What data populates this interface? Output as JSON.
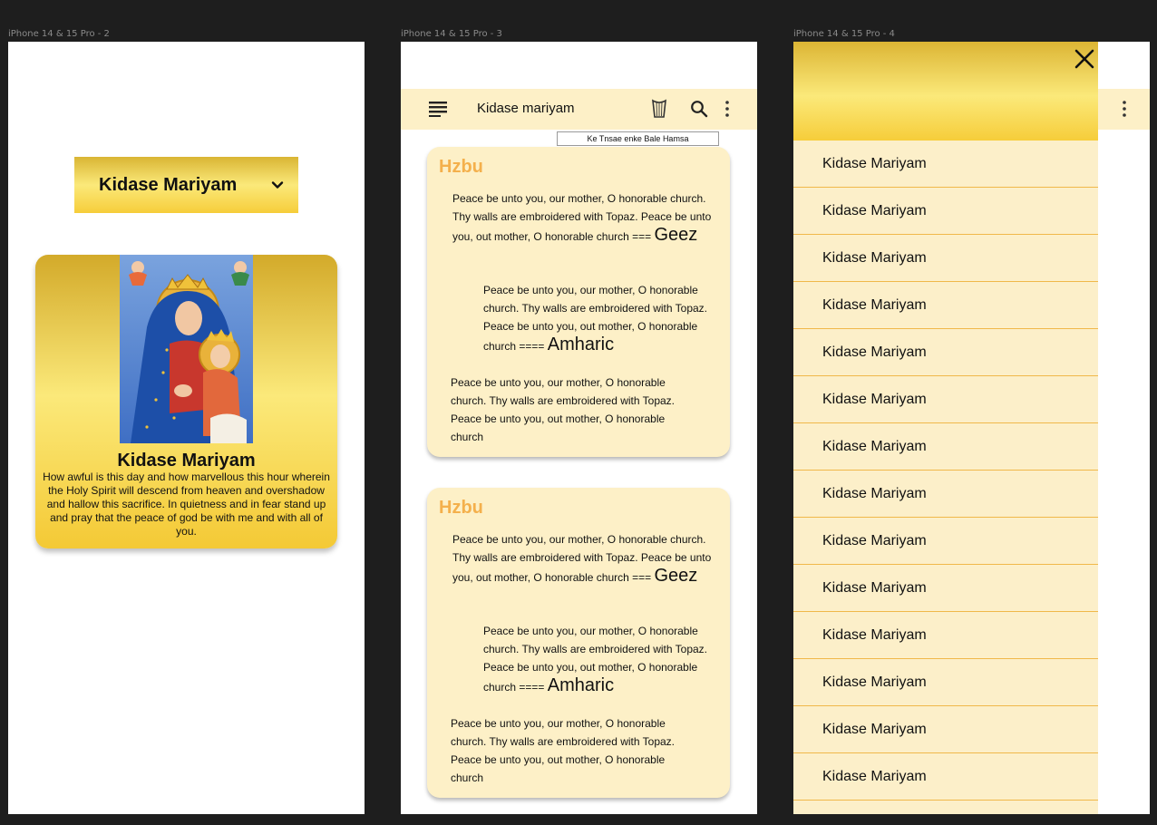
{
  "frames": [
    {
      "label": "iPhone 14 & 15 Pro - 2"
    },
    {
      "label": "iPhone 14 & 15 Pro - 3"
    },
    {
      "label": "iPhone 14 & 15 Pro - 4"
    }
  ],
  "home": {
    "select_label": "Kidase Mariyam",
    "card_title": "Kidase Mariyam",
    "card_desc": "How awful is this day and how marvellous this hour wherein the Holy Spirit will descend from heaven and overshadow and hallow this sacrifice. In quietness and in fear stand up and pray that the peace of god be with me and with all of you."
  },
  "reader": {
    "appbar_title": "Kidase mariyam",
    "tooltip": "Ke Tnsae enke Bale Hamsa",
    "cards": [
      {
        "heading": "Hzbu",
        "geez_text": "Peace be unto you, our mother, O honorable church. Thy walls are embroidered with Topaz. Peace be unto you, out mother, O honorable church ===",
        "geez_label": "Geez",
        "amharic_text": "Peace be unto you, our mother, O honorable church. Thy walls are embroidered with Topaz. Peace be unto you, out mother, O honorable church ====",
        "amharic_label": "Amharic",
        "english_text": "Peace be unto you, our mother, O honorable church. Thy walls are embroidered with Topaz. Peace be unto you, out mother, O honorable church"
      },
      {
        "heading": "Hzbu",
        "geez_text": "Peace be unto you, our mother, O honorable church. Thy walls are embroidered with Topaz. Peace be unto you, out mother, O honorable church ===",
        "geez_label": "Geez",
        "amharic_text": "Peace be unto you, our mother, O honorable church. Thy walls are embroidered with Topaz. Peace be unto you, out mother, O honorable church ====",
        "amharic_label": "Amharic",
        "english_text": "Peace be unto you, our mother, O honorable church. Thy walls are embroidered with Topaz. Peace be unto you, out mother, O honorable church"
      }
    ]
  },
  "drawer": {
    "items": [
      "Kidase Mariyam",
      "Kidase Mariyam",
      "Kidase Mariyam",
      "Kidase Mariyam",
      "Kidase Mariyam",
      "Kidase Mariyam",
      "Kidase Mariyam",
      "Kidase Mariyam",
      "Kidase Mariyam",
      "Kidase Mariyam",
      "Kidase Mariyam",
      "Kidase Mariyam",
      "Kidase Mariyam",
      "Kidase Mariyam"
    ]
  },
  "colors": {
    "canvas": "#1e1e1e",
    "cream": "#fdf0c7",
    "gold": "#f6cd3a",
    "heading_orange": "#f4b04c",
    "divider": "#f0b84a"
  },
  "icons": [
    "chevron-down-icon",
    "hamburger-icon",
    "harp-icon",
    "search-icon",
    "more-vert-icon",
    "close-icon"
  ]
}
